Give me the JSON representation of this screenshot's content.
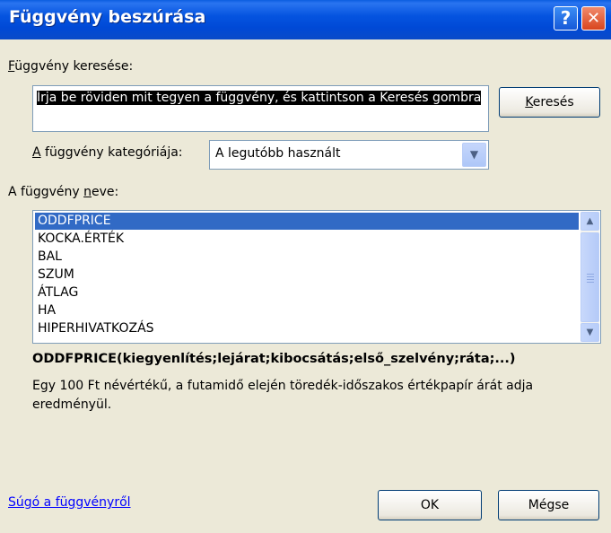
{
  "window": {
    "title": "Függvény beszúrása",
    "help_button": "?",
    "close_button": "✕"
  },
  "search": {
    "label": "Függvény keresése:",
    "value": "Írja be röviden mit tegyen a függvény, és kattintson a Keresés gombra",
    "button": "Keresés"
  },
  "category": {
    "label": "A függvény kategóriája:",
    "selected": "A legutóbb használt"
  },
  "function_list": {
    "label": "A függvény neve:",
    "items": [
      "ODDFPRICE",
      "KOCKA.ÉRTÉK",
      "BAL",
      "SZUM",
      "ÁTLAG",
      "HA",
      "HIPERHIVATKOZÁS"
    ],
    "selected_index": 0
  },
  "details": {
    "syntax": "ODDFPRICE(kiegyenlítés;lejárat;kibocsátás;első_szelvény;ráta;...)",
    "description": "Egy 100 Ft névértékű, a futamidő elején töredék-időszakos értékpapír árát adja eredményül."
  },
  "footer": {
    "help_link": "Súgó a függvényről",
    "ok": "OK",
    "cancel": "Mégse"
  }
}
